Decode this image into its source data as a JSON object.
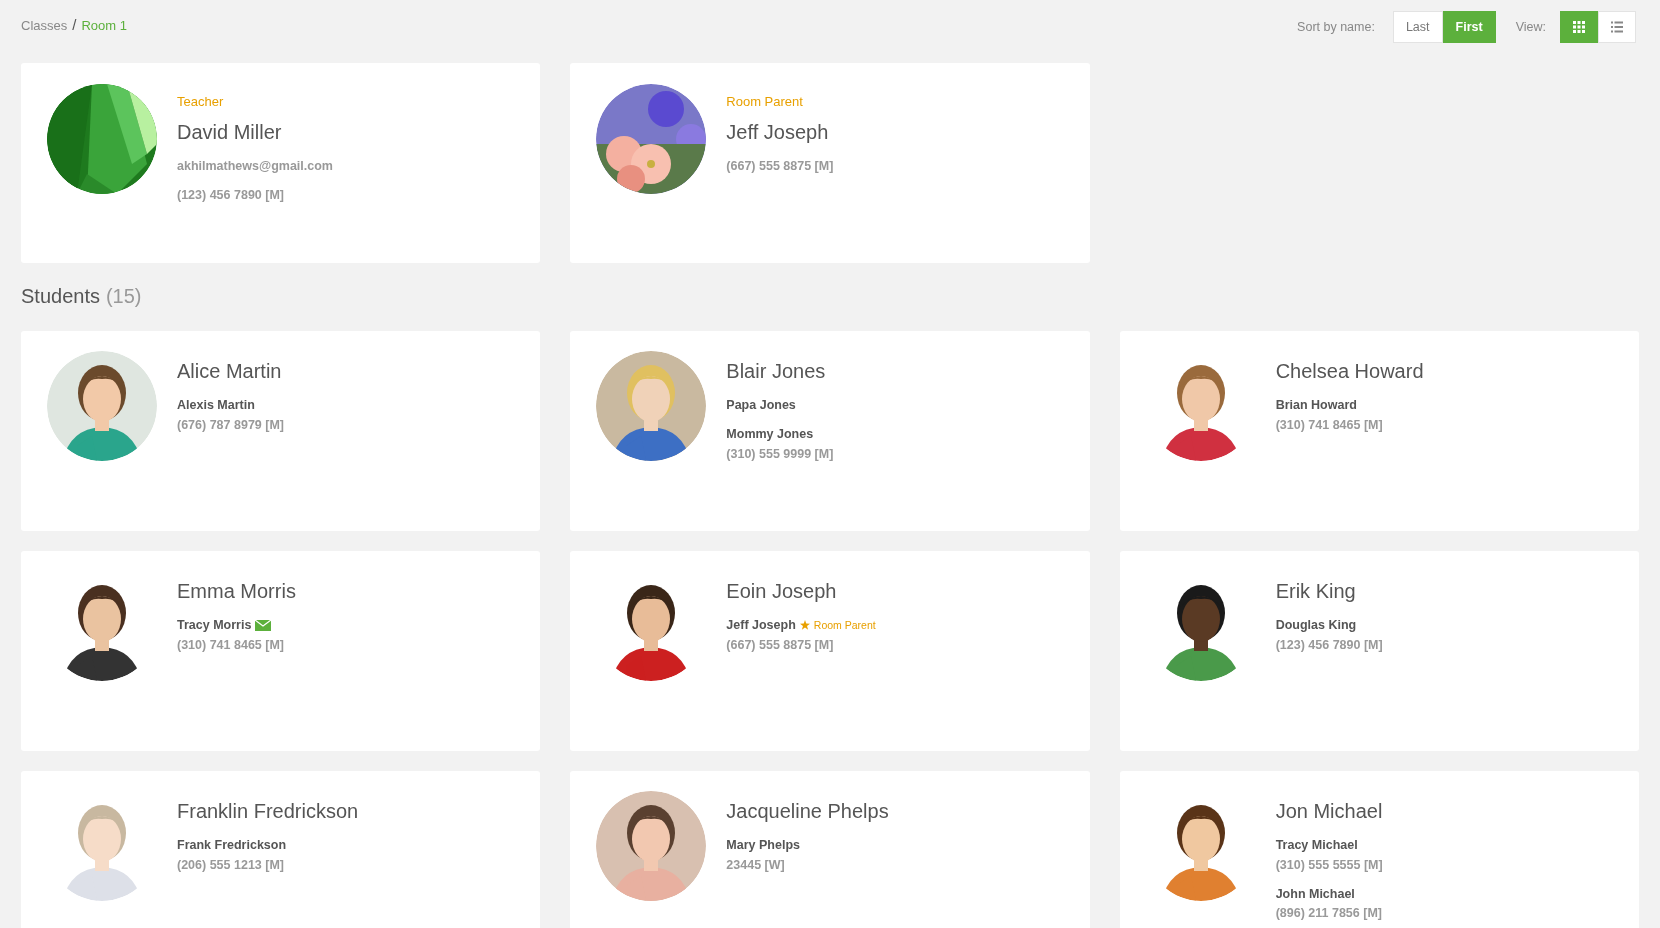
{
  "breadcrumb": {
    "items": [
      {
        "label": "Classes",
        "current": false
      },
      {
        "label": "Room 1",
        "current": true
      }
    ],
    "separator": "/"
  },
  "sort": {
    "label": "Sort by name:",
    "options": [
      {
        "label": "Last",
        "selected": false
      },
      {
        "label": "First",
        "selected": true
      }
    ]
  },
  "view": {
    "label": "View:",
    "options": [
      {
        "kind": "grid",
        "selected": true
      },
      {
        "kind": "list",
        "selected": false
      }
    ]
  },
  "staff": [
    {
      "role": "Teacher",
      "name": "David Miller",
      "lines": [
        "akhilmathews@gmail.com",
        "(123) 456 7890 [M]"
      ]
    },
    {
      "role": "Room Parent",
      "name": "Jeff Joseph",
      "lines": [
        "(667) 555 8875 [M]"
      ]
    }
  ],
  "students_heading": {
    "title": "Students",
    "count": "(15)"
  },
  "students": [
    {
      "name": "Alice Martin",
      "contacts": [
        {
          "name": "Alexis Martin",
          "email": false,
          "phone": "(676) 787 8979 [M]"
        }
      ]
    },
    {
      "name": "Blair Jones",
      "contacts": [
        {
          "name": "Papa Jones",
          "email": false
        },
        {
          "name": "Mommy Jones",
          "email": false,
          "phone": "(310) 555 9999 [M]"
        }
      ]
    },
    {
      "name": "Chelsea Howard",
      "contacts": [
        {
          "name": "Brian Howard",
          "email": false,
          "phone": "(310) 741 8465 [M]"
        }
      ]
    },
    {
      "name": "Emma Morris",
      "contacts": [
        {
          "name": "Tracy Morris",
          "email": true,
          "phone": "(310) 741 8465 [M]"
        }
      ]
    },
    {
      "name": "Eoin Joseph",
      "contacts": [
        {
          "name": "Jeff Joseph",
          "email": false,
          "role": "Room Parent",
          "phone": "(667) 555 8875 [M]"
        }
      ]
    },
    {
      "name": "Erik King",
      "contacts": [
        {
          "name": "Douglas King",
          "email": false,
          "phone": "(123) 456 7890 [M]"
        }
      ]
    },
    {
      "name": "Franklin Fredrickson",
      "contacts": [
        {
          "name": "Frank Fredrickson",
          "email": false,
          "phone": "(206) 555 1213 [M]"
        }
      ]
    },
    {
      "name": "Jacqueline Phelps",
      "contacts": [
        {
          "name": "Mary Phelps",
          "email": false,
          "phone": "23445 [W]"
        }
      ]
    },
    {
      "name": "Jon Michael",
      "contacts": [
        {
          "name": "Tracy Michael",
          "email": false,
          "phone": "(310) 555 5555 [M]"
        },
        {
          "name": "John Michael",
          "email": false,
          "phone": "(896) 211 7856 [M]"
        }
      ]
    }
  ]
}
